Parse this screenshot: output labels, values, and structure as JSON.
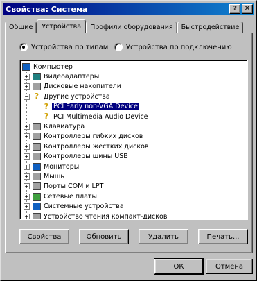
{
  "window": {
    "title": "Свойства: Система",
    "help_button": "?",
    "close_button": "✕"
  },
  "tabs": [
    {
      "label": "Общие"
    },
    {
      "label": "Устройства"
    },
    {
      "label": "Профили оборудования"
    },
    {
      "label": "Быстродействие"
    }
  ],
  "view_mode": {
    "by_type": "Устройства по типам",
    "by_connection": "Устройства по подключению",
    "selected": "by_type"
  },
  "tree": {
    "root": "Компьютер",
    "items": [
      {
        "label": "Видеоадаптеры",
        "icon": "display-adapter-icon",
        "expanded": false
      },
      {
        "label": "Дисковые накопители",
        "icon": "disk-drive-icon",
        "expanded": false
      },
      {
        "label": "Другие устройства",
        "icon": "unknown-device-icon",
        "expanded": true,
        "children": [
          {
            "label": "PCI Early non-VGA Device",
            "icon": "warning-device-icon",
            "selected": true
          },
          {
            "label": "PCI Multimedia Audio Device",
            "icon": "warning-device-icon",
            "selected": false
          }
        ]
      },
      {
        "label": "Клавиатура",
        "icon": "keyboard-icon",
        "expanded": false
      },
      {
        "label": "Контроллеры гибких дисков",
        "icon": "floppy-controller-icon",
        "expanded": false
      },
      {
        "label": "Контроллеры жестких дисков",
        "icon": "hdd-controller-icon",
        "expanded": false
      },
      {
        "label": "Контроллеры шины USB",
        "icon": "usb-controller-icon",
        "expanded": false
      },
      {
        "label": "Мониторы",
        "icon": "monitor-icon",
        "expanded": false
      },
      {
        "label": "Мышь",
        "icon": "mouse-icon",
        "expanded": false
      },
      {
        "label": "Порты COM и LPT",
        "icon": "port-icon",
        "expanded": false
      },
      {
        "label": "Сетевые платы",
        "icon": "network-card-icon",
        "expanded": false
      },
      {
        "label": "Системные устройства",
        "icon": "system-device-icon",
        "expanded": false
      },
      {
        "label": "Устройство чтения компакт-дисков",
        "icon": "cdrom-icon",
        "expanded": false
      }
    ]
  },
  "actions": {
    "properties": "Свойства",
    "refresh": "Обновить",
    "remove": "Удалить",
    "print": "Печать..."
  },
  "footer": {
    "ok": "ОК",
    "cancel": "Отмена"
  }
}
